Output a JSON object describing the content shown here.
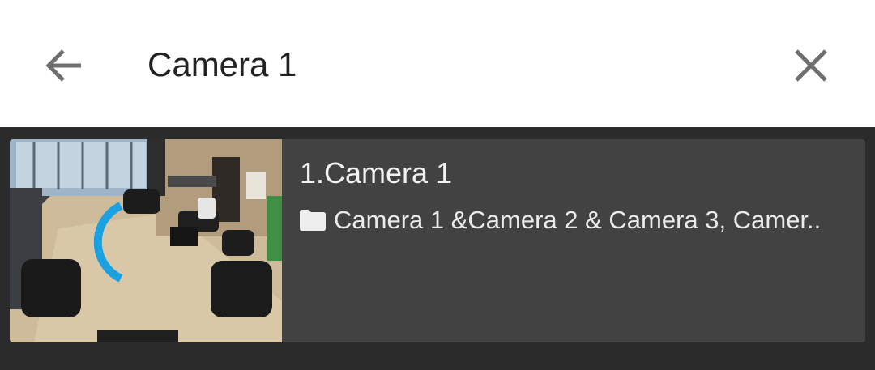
{
  "search": {
    "query": "Camera 1",
    "back_icon": "arrow-left-icon",
    "clear_icon": "close-icon"
  },
  "results": [
    {
      "title": "1.Camera 1",
      "folder_icon": "folder-icon",
      "path": "Camera 1 &Camera 2 & Camera 3, Camer..",
      "thumbnail": "camera-preview",
      "loading": true
    }
  ],
  "colors": {
    "accent": "#1ba1e2",
    "card": "#424242",
    "background": "#2b2b2b"
  }
}
